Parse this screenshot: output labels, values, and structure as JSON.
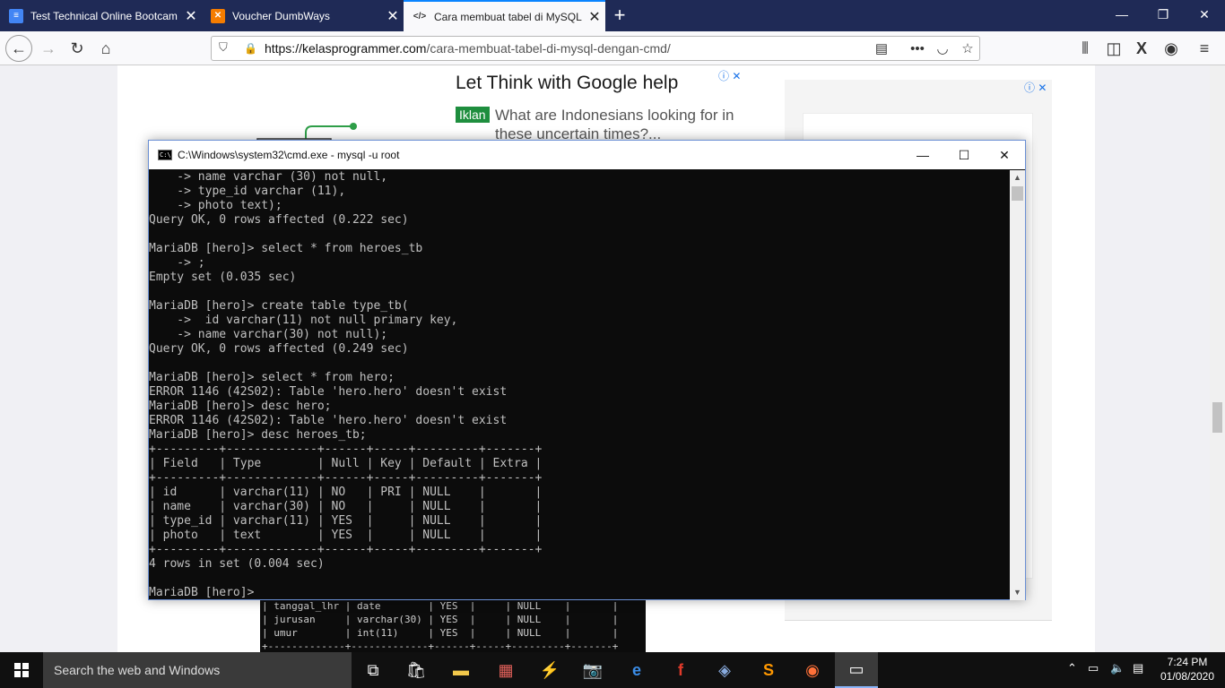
{
  "browser": {
    "tabs": [
      {
        "label": "Test Technical Online Bootcam",
        "icon": "docs-icon",
        "active": false
      },
      {
        "label": "Voucher DumbWays",
        "icon": "xampp-icon",
        "active": false
      },
      {
        "label": "Cara membuat tabel di MySQL",
        "icon": "code-icon",
        "active": true
      }
    ],
    "new_tab": "+",
    "url_domain": "https://kelasprogrammer.com",
    "url_path": "/cara-membuat-tabel-di-mysql-dengan-cmd/"
  },
  "page": {
    "ad_title": "Let Think with Google help",
    "ad_badge": "Iklan",
    "ad_text": "What are Indonesians looking for in these uncertain times?...",
    "ad_info": "ⓘ ✕",
    "side_ad_info": "ⓘ ✕",
    "bg_terminal": "| tanggal_lhr | date        | YES  |     | NULL    |       |\n| jurusan     | varchar(30) | YES  |     | NULL    |       |\n| umur        | int(11)     | YES  |     | NULL    |       |\n+-------------+-------------+------+-----+---------+-------+"
  },
  "cmd": {
    "title": "C:\\Windows\\system32\\cmd.exe - mysql  -u root",
    "output": "    -> name varchar (30) not null,\n    -> type_id varchar (11),\n    -> photo text);\nQuery OK, 0 rows affected (0.222 sec)\n\nMariaDB [hero]> select * from heroes_tb\n    -> ;\nEmpty set (0.035 sec)\n\nMariaDB [hero]> create table type_tb(\n    ->  id varchar(11) not null primary key,\n    -> name varchar(30) not null);\nQuery OK, 0 rows affected (0.249 sec)\n\nMariaDB [hero]> select * from hero;\nERROR 1146 (42S02): Table 'hero.hero' doesn't exist\nMariaDB [hero]> desc hero;\nERROR 1146 (42S02): Table 'hero.hero' doesn't exist\nMariaDB [hero]> desc heroes_tb;\n+---------+-------------+------+-----+---------+-------+\n| Field   | Type        | Null | Key | Default | Extra |\n+---------+-------------+------+-----+---------+-------+\n| id      | varchar(11) | NO   | PRI | NULL    |       |\n| name    | varchar(30) | NO   |     | NULL    |       |\n| type_id | varchar(11) | YES  |     | NULL    |       |\n| photo   | text        | YES  |     | NULL    |       |\n+---------+-------------+------+-----+---------+-------+\n4 rows in set (0.004 sec)\n\nMariaDB [hero]> "
  },
  "taskbar": {
    "search_placeholder": "Search the web and Windows",
    "time": "7:24 PM",
    "date": "01/08/2020"
  },
  "colors": {
    "tabstrip": "#1f2a56",
    "accent": "#0a84ff",
    "ad_badge": "#1e8e3e",
    "terminal_bg": "#0c0c0c"
  }
}
